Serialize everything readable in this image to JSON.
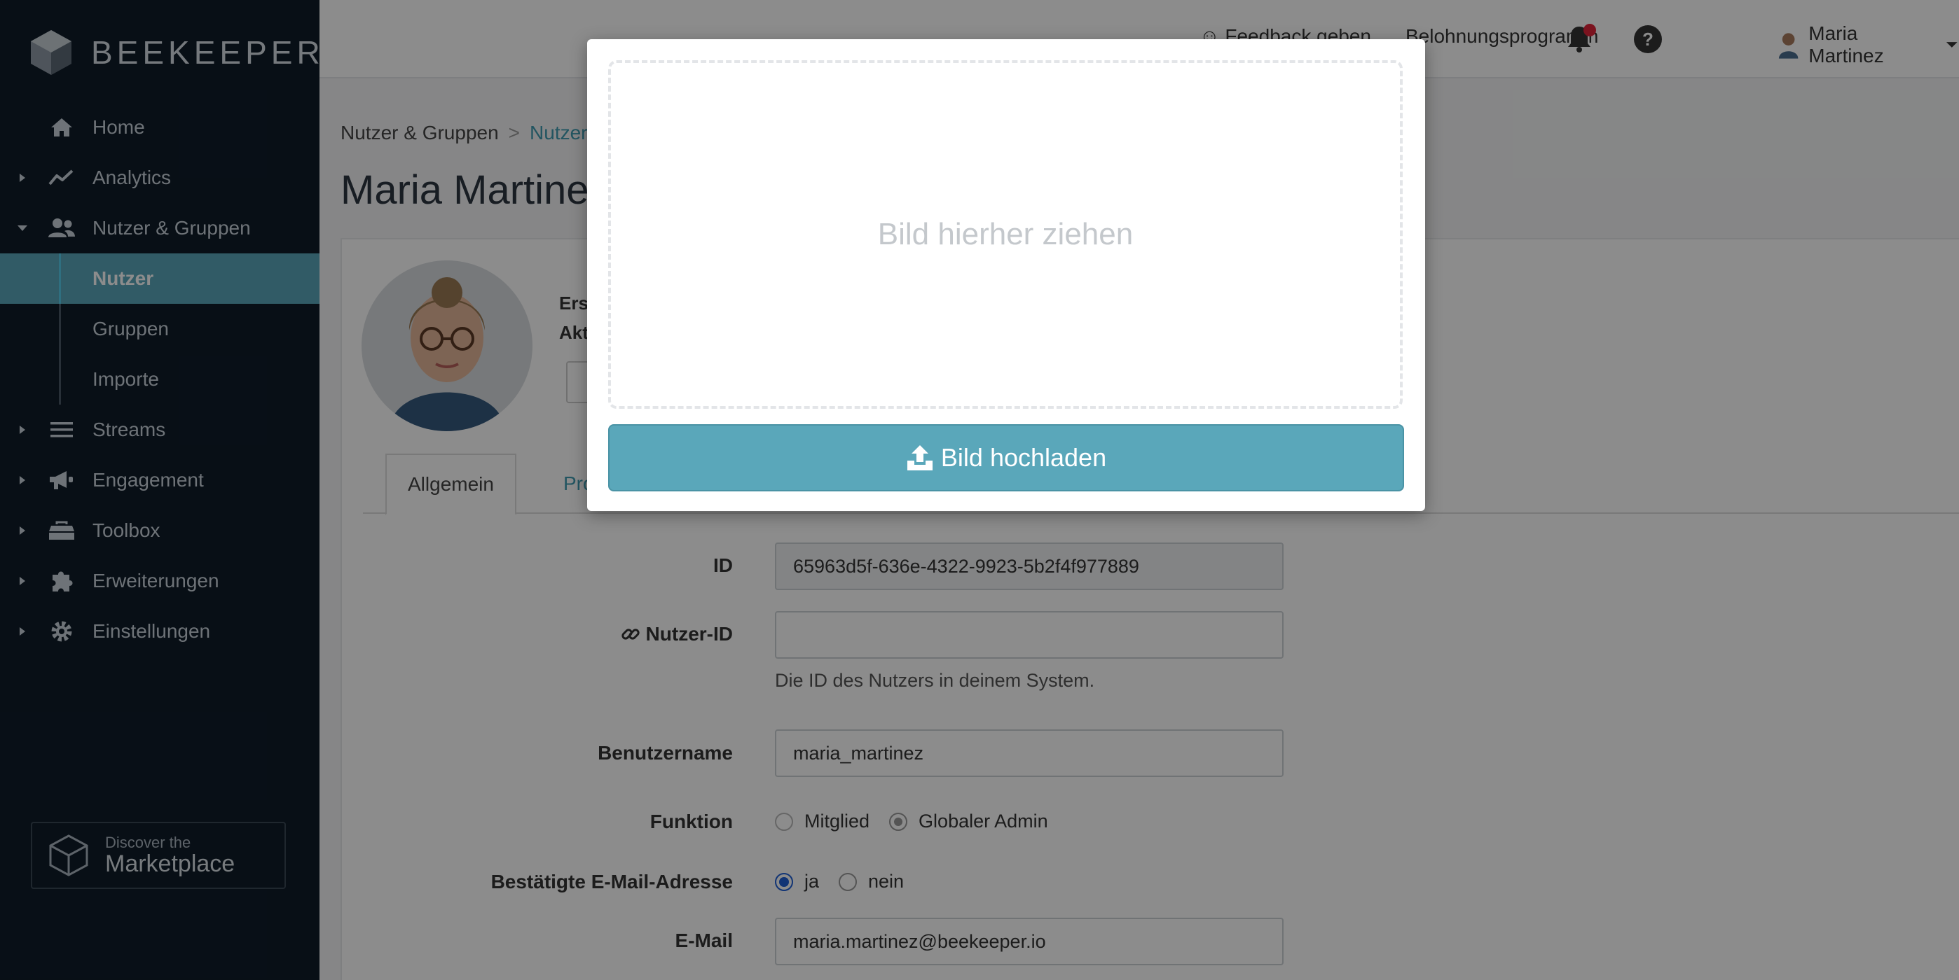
{
  "brand": {
    "name": "BEEKEEPER"
  },
  "sidebar": {
    "items": [
      {
        "label": "Home",
        "icon": "home-icon"
      },
      {
        "label": "Analytics",
        "icon": "analytics-icon"
      },
      {
        "label": "Nutzer & Gruppen",
        "icon": "users-icon"
      },
      {
        "label": "Streams",
        "icon": "streams-icon"
      },
      {
        "label": "Engagement",
        "icon": "megaphone-icon"
      },
      {
        "label": "Toolbox",
        "icon": "toolbox-icon"
      },
      {
        "label": "Erweiterungen",
        "icon": "puzzle-icon"
      },
      {
        "label": "Einstellungen",
        "icon": "gear-icon"
      }
    ],
    "subitems": [
      {
        "label": "Nutzer",
        "active": true
      },
      {
        "label": "Gruppen"
      },
      {
        "label": "Importe"
      }
    ],
    "marketplace": {
      "small": "Discover the",
      "big": "Marketplace"
    }
  },
  "topbar": {
    "feedback": "Feedback geben",
    "rewards": "Belohnungsprogramm",
    "user_name": "Maria Martinez"
  },
  "main": {
    "breadcrumb": {
      "root": "Nutzer & Gruppen",
      "separator": ">",
      "current": "Nutzer"
    },
    "title": "Maria Martine",
    "meta_line1": "Ers",
    "meta_line2": "Akt",
    "tabs": {
      "general": "Allgemein",
      "profile": "Profil"
    },
    "form": {
      "id_label": "ID",
      "id_value": "65963d5f-636e-4322-9923-5b2f4f977889",
      "user_id_label": "Nutzer-ID",
      "user_id_value": "",
      "user_id_help": "Die ID des Nutzers in deinem System.",
      "username_label": "Benutzername",
      "username_value": "maria_martinez",
      "function_label": "Funktion",
      "function_option1": "Mitglied",
      "function_option2": "Globaler Admin",
      "function_selected": "Globaler Admin",
      "email_verified_label": "Bestätigte E-Mail-Adresse",
      "email_verified_yes": "ja",
      "email_verified_no": "nein",
      "email_verified_selected": "ja",
      "email_label": "E-Mail",
      "email_value": "maria.martinez@beekeeper.io"
    }
  },
  "modal": {
    "dropzone_text": "Bild hierher ziehen",
    "upload_button": "Bild hochladen"
  },
  "colors": {
    "sidebar_bg": "#0f1c29",
    "accent": "#5aa7ba",
    "link": "#3e9bb1",
    "notification": "#e0243a"
  }
}
